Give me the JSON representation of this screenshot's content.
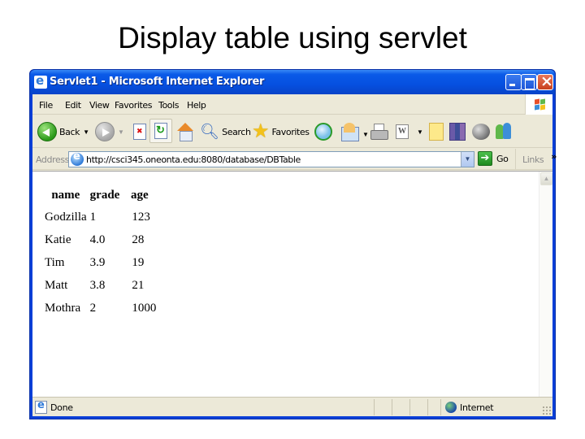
{
  "slide": {
    "title": "Display table using servlet"
  },
  "window": {
    "title": "Servlet1 - Microsoft Internet Explorer",
    "controls": {
      "minimize": "minimize",
      "maximize": "maximize",
      "close": "close"
    }
  },
  "menubar": {
    "items": [
      {
        "label": "File"
      },
      {
        "label": "Edit"
      },
      {
        "label": "View"
      },
      {
        "label": "Favorites"
      },
      {
        "label": "Tools"
      },
      {
        "label": "Help"
      }
    ]
  },
  "toolbar": {
    "back_label": "Back",
    "search_label": "Search",
    "favorites_label": "Favorites",
    "icons": [
      "back-icon",
      "forward-icon",
      "stop-icon",
      "refresh-icon",
      "home-icon",
      "search-icon",
      "favorites-star-icon",
      "history-icon",
      "mail-icon",
      "print-icon",
      "word-edit-icon",
      "notes-icon",
      "research-icon",
      "messenger-icon",
      "contacts-icon"
    ]
  },
  "addressbar": {
    "label": "Address",
    "url": "http://csci345.oneonta.edu:8080/database/DBTable",
    "go_label": "Go",
    "links_label": "Links",
    "links_more": "»"
  },
  "page": {
    "table": {
      "headers": [
        "name",
        "grade",
        "age"
      ],
      "rows": [
        [
          "Godzilla",
          "1",
          "123"
        ],
        [
          "Katie",
          "4.0",
          "28"
        ],
        [
          "Tim",
          "3.9",
          "19"
        ],
        [
          "Matt",
          "3.8",
          "21"
        ],
        [
          "Mothra",
          "2",
          "1000"
        ]
      ]
    }
  },
  "statusbar": {
    "status": "Done",
    "zone": "Internet"
  },
  "colors": {
    "titlebar": "#0650e0",
    "chrome": "#ece9d8",
    "close_button": "#c8401e"
  }
}
